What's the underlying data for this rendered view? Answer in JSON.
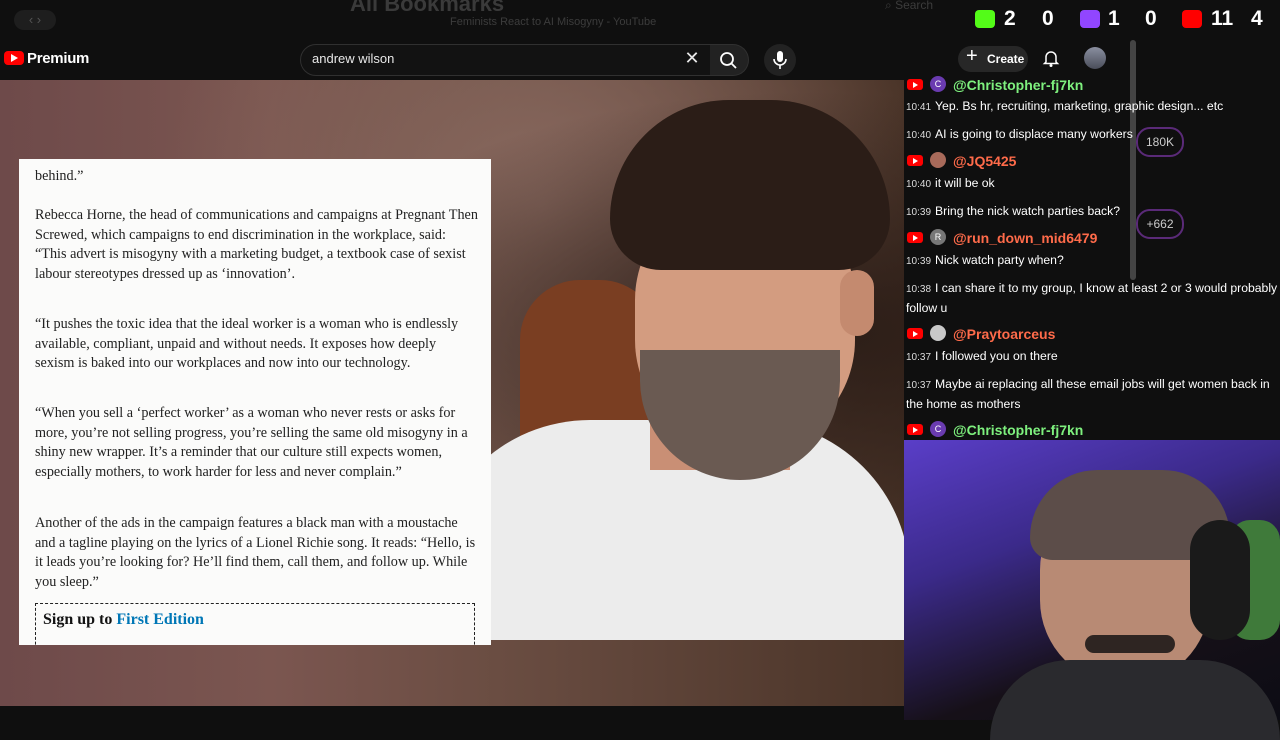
{
  "browser": {
    "bookmarks_title": "All Bookmarks",
    "tab_title": "Feminists React to AI Misogyny - YouTube",
    "search_hint": "Search"
  },
  "header": {
    "logo_text": "Premium",
    "search_value": "andrew wilson",
    "create_label": "Create"
  },
  "stats": [
    {
      "icon": "kick-icon",
      "color": "#53fc18",
      "values": [
        "2",
        "0"
      ]
    },
    {
      "icon": "twitch-icon",
      "color": "#9146ff",
      "values": [
        "1",
        "0"
      ]
    },
    {
      "icon": "youtube-icon",
      "color": "#ff0000",
      "values": [
        "11",
        "4"
      ]
    }
  ],
  "article": {
    "p0": "behind.”",
    "p1": "Rebecca Horne, the head of communications and campaigns at Pregnant Then Screwed, which campaigns to end discrimination in the workplace, said: “This advert is misogyny with a marketing budget, a textbook case of sexist labour stereotypes dressed up as ‘innovation’.",
    "p2": "“It pushes the toxic idea that the ideal worker is a woman who is endlessly available, compliant, unpaid and without needs. It exposes how deeply sexism is baked into our workplaces and now into our technology.",
    "p3": "“When you sell a ‘perfect worker’ as a woman who never rests or asks for more, you’re not selling progress, you’re selling the same old misogyny in a shiny new wrapper. It’s a reminder that our culture still expects women, especially mothers, to work harder for less and never complain.”",
    "p4": "Another of the ads in the campaign features a black man with a moustache and a tagline playing on the lyrics of a Lionel Richie song. It reads: “Hello, is it leads you’re looking for? He’ll find them, call them, and follow up. While you sleep.”",
    "signup_prefix": "Sign up to ",
    "signup_link": "First Edition"
  },
  "chat": {
    "users": [
      {
        "name": "@Christopher-fj7kn",
        "initial": "C",
        "color": "#7ef07e"
      },
      {
        "name": "@JQ5425",
        "initial": "",
        "color": "#ff6b4a"
      },
      {
        "name": "@run_down_mid6479",
        "initial": "R",
        "color": "#ff6b4a"
      },
      {
        "name": "@Praytoarceus",
        "initial": "",
        "color": "#ff6b4a"
      },
      {
        "name": "@Christopher-fj7kn",
        "initial": "C",
        "color": "#7ef07e"
      }
    ],
    "messages": [
      {
        "time": "10:41",
        "text": "Yep. Bs hr, recruiting, marketing, graphic design... etc"
      },
      {
        "time": "10:40",
        "text": "AI is going to displace many workers"
      },
      {
        "time": "10:40",
        "text": "it will be ok"
      },
      {
        "time": "10:39",
        "text": "Bring the nick watch parties back?"
      },
      {
        "time": "10:39",
        "text": "Nick watch party when?"
      },
      {
        "time": "10:38",
        "text": "I can share it to my group, I know at least 2 or 3 would probably follow u"
      },
      {
        "time": "10:37",
        "text": "I followed you on there"
      },
      {
        "time": "10:37",
        "text": "Maybe ai replacing all these email jobs will get women back in the home as mothers"
      }
    ],
    "ghost_pills": [
      "180K",
      "+662"
    ]
  }
}
